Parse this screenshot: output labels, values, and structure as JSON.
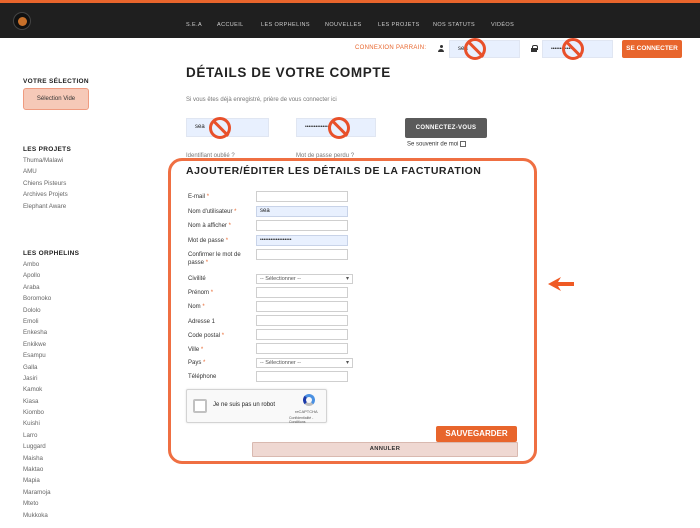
{
  "header": {
    "nav": [
      "S.E.A",
      "ACCUEIL",
      "LES ORPHELINS",
      "NOUVELLES",
      "LES PROJETS",
      "NOS STATUTS",
      "VIDÉOS"
    ],
    "login_label": "CONNEXION PARRAIN:",
    "username_value": "sea",
    "password_value": "••••••••••••",
    "login_button": "SE CONNECTER"
  },
  "sidebar": {
    "selection_heading": "VOTRE SÉLECTION",
    "selection_box": "Sélection Vide",
    "projects_heading": "LES PROJETS",
    "projects": [
      "Thuma/Malawi",
      "AMU",
      "Chiens Pisteurs",
      "Archives Projets",
      "Elephant Aware"
    ],
    "orphans_heading": "LES ORPHELINS",
    "orphans": [
      "Ambo",
      "Apollo",
      "Araba",
      "Boromoko",
      "Dololo",
      "Emoli",
      "Enkesha",
      "Enkikwe",
      "Esampu",
      "Galla",
      "Jasiri",
      "Kamok",
      "Kiasa",
      "Kiombo",
      "Kuishi",
      "Larro",
      "Luggard",
      "Maisha",
      "Maktao",
      "Mapia",
      "Maramoja",
      "Mteto",
      "Mukkoka"
    ]
  },
  "account": {
    "title": "DÉTAILS DE VOTRE COMPTE",
    "hint": "Si vous êtes déjà enregistré, prière de vous connecter ici",
    "username_value": "sea",
    "password_value": "••••••••••••••",
    "connect_button": "CONNECTEZ-VOUS",
    "remember_label": "Se souvenir de moi",
    "forgot_username": "Identifiant oublié ?",
    "forgot_password": "Mot de passe perdu ?"
  },
  "billing": {
    "title": "AJOUTER/ÉDITER LES DÉTAILS DE LA FACTURATION",
    "labels": {
      "email": "E-mail",
      "username": "Nom d'utilisateur",
      "display_name": "Nom à afficher",
      "password": "Mot de passe",
      "confirm_line1": "Confirmer le mot de",
      "confirm_line2": "passe",
      "civility": "Civilité",
      "firstname": "Prénom",
      "lastname": "Nom",
      "address": "Adresse 1",
      "postal": "Code postal",
      "city": "Ville",
      "country": "Pays",
      "phone": "Téléphone"
    },
    "req": "*",
    "username_value": "sea",
    "password_value": "••••••••••••••••••",
    "select_placeholder": "-- Sélectionner --",
    "captcha_label": "Je ne suis pas un robot",
    "captcha_brand": "reCAPTCHA",
    "captcha_terms": "Confidentialité - Conditions",
    "save_button": "SAUVEGARDER",
    "cancel_button": "ANNULER"
  },
  "colors": {
    "accent": "#e8652c",
    "topbar": "#1f1f1f",
    "annotation": "#ef6f42"
  }
}
